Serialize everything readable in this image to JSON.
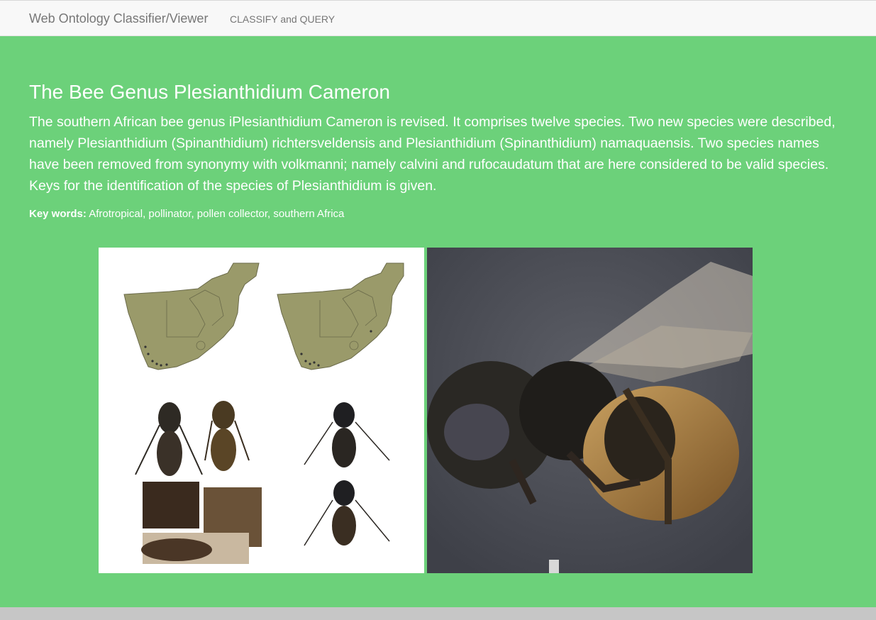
{
  "navbar": {
    "brand": "Web Ontology Classifier/Viewer",
    "link": "CLASSIFY and QUERY"
  },
  "article": {
    "title": "The Bee Genus Plesianthidium Cameron",
    "abstract": "The southern African bee genus iPlesianthidium Cameron is revised. It comprises twelve species. Two new species were described, namely Plesianthidium (Spinanthidium) richtersveldensis and Plesianthidium (Spinanthidium) namaquaensis. Two species names have been removed from synonymy with volkmanni; namely calvini and rufocaudatum that are here considered to be valid species. Keys for the identification of the species of Plesianthidium is given.",
    "keywords_label": "Key words:",
    "keywords_text": "Afrotropical, pollinator, pollen collector, southern Africa"
  },
  "figures": {
    "left": "maps and bee specimen plates",
    "right": "bee close-up photograph"
  },
  "colors": {
    "hero_bg": "#6cd17a",
    "navbar_bg": "#f8f8f8",
    "map_fill": "#9a9a6a"
  }
}
